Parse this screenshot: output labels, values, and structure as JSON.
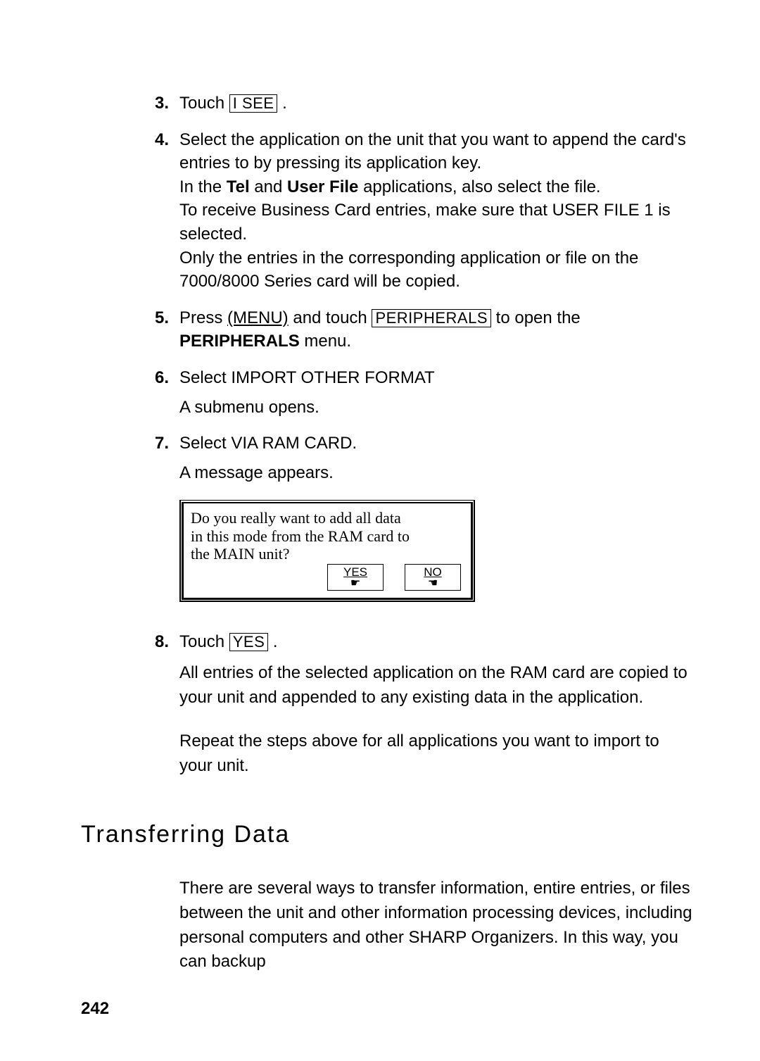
{
  "steps": {
    "s3": {
      "num": "3.",
      "t1": "Touch ",
      "btn": "I SEE",
      "t2": " ."
    },
    "s4": {
      "num": "4.",
      "p1a": "Select the application on the unit that you want to append the card's entries to by pressing its application key.",
      "p1b_pre": "In the ",
      "p1b_b1": "Tel",
      "p1b_mid": " and ",
      "p1b_b2": "User File",
      "p1b_post": " applications, also select the file.",
      "p1c": "To receive Business Card entries, make sure that USER FILE 1 is selected.",
      "p1d": "Only the entries in the corresponding application or file on the 7000/8000 Series card will be copied."
    },
    "s5": {
      "num": "5.",
      "t1": "Press ",
      "menu": "(MENU)",
      "t2": " and touch ",
      "btn": "PERIPHERALS",
      "t3": " to open the ",
      "bold": "PERIPHERALS",
      "t4": " menu."
    },
    "s6": {
      "num": "6.",
      "t1": "Select IMPORT OTHER FORMAT",
      "t2": "A submenu opens."
    },
    "s7": {
      "num": "7.",
      "t1": "Select VIA RAM CARD.",
      "t2": "A message appears."
    },
    "s8": {
      "num": "8.",
      "t1": "Touch ",
      "btn": "YES",
      "t2": " .",
      "p1": "All entries of the selected application on the RAM card are copied to your unit and appended to any existing data in the application.",
      "p2": "Repeat the steps above for all applications you want to import to your unit."
    }
  },
  "dialog": {
    "line1": "Do you really want to add all data",
    "line2": "in this mode from the RAM card to",
    "line3": "the MAIN unit?",
    "yes": "YES",
    "no": "NO",
    "hand_left": "☚",
    "hand_right": "☛"
  },
  "section": {
    "title": "Transferring  Data",
    "para": "There are several ways to transfer information, entire entries, or files between the unit and other information processing devices, including personal computers and other SHARP Organizers. In this way, you can backup"
  },
  "page_number": "242"
}
